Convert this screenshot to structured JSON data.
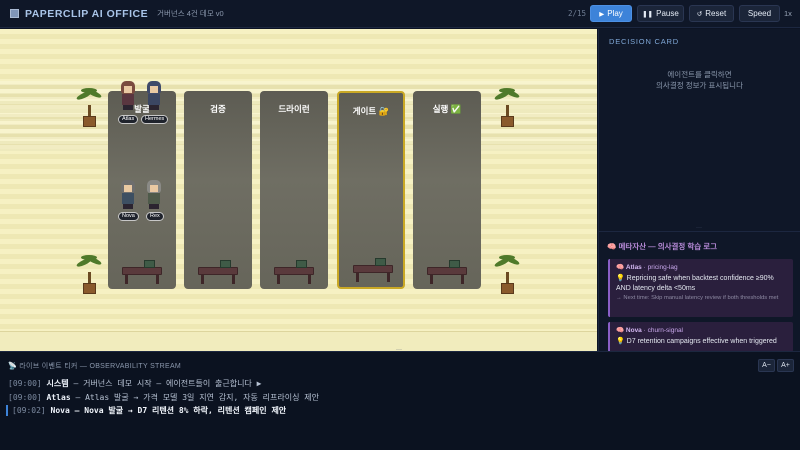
{
  "header": {
    "title": "PAPERCLIP AI OFFICE",
    "subtitle": "거버넌스 4건 데모 v0",
    "step": "2/15",
    "buttons": {
      "play": "Play",
      "pause": "Pause",
      "reset": "Reset",
      "speed": "Speed"
    },
    "speed_value": "1x"
  },
  "stages": [
    {
      "label": "발굴",
      "active": false
    },
    {
      "label": "검증",
      "active": false
    },
    {
      "label": "드라이런",
      "active": false
    },
    {
      "label": "게이트 🔐",
      "active": true
    },
    {
      "label": "실행 ✅",
      "active": false
    }
  ],
  "agents": [
    "Atlas",
    "Hermes",
    "Nova",
    "Rex"
  ],
  "decision_card": {
    "title": "DECISION CARD",
    "hint_line1": "에이전트를 클릭하면",
    "hint_line2": "의사결정 정보가 표시됩니다"
  },
  "meta_log": {
    "title": "메타자산 — 의사결정 학습 로그",
    "items": [
      {
        "agent": "Atlas",
        "topic": "pricing-lag",
        "text": "Repricing safe when backtest confidence ≥90% AND latency delta <50ms",
        "next": "→ Next time: Skip manual latency review if both thresholds met"
      },
      {
        "agent": "Nova",
        "topic": "churn-signal",
        "text": "D7 retention campaigns effective when triggered",
        "next": ""
      }
    ]
  },
  "stream": {
    "title": "라이브 이벤트 티커 — OBSERVABILITY STREAM",
    "zoom_out": "A−",
    "zoom_in": "A+",
    "events": [
      {
        "ts": "[09:00]",
        "who": "시스템",
        "msg": " — 거버넌스 데모 시작 — 에이전트들이 출근합니다 ▶"
      },
      {
        "ts": "[09:00]",
        "who": "Atlas",
        "msg": " — Atlas 발굴 → 가격 모델 3일 지연 감지, 자동 리프라이싱 제안"
      },
      {
        "ts": "[09:02]",
        "who": "Nova",
        "msg": " — Nova 발굴 → D7 리텐션 8% 하락, 리텐션 캠페인 제안"
      }
    ]
  },
  "colors": {
    "accent": "#3d83d9",
    "gate": "#c9a825",
    "meta": "#8a5fc7"
  }
}
